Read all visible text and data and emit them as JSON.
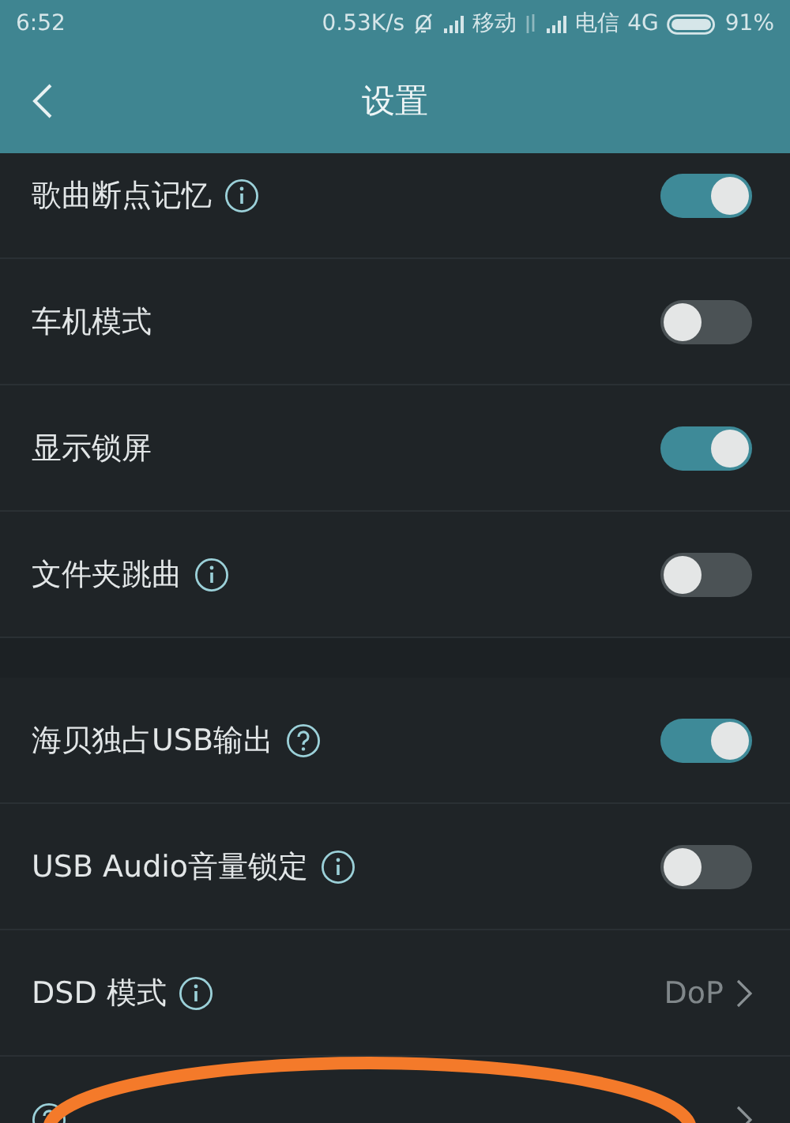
{
  "status_bar": {
    "time": "6:52",
    "speed": "0.53K/s",
    "carrier_1": "移动",
    "carrier_2": "电信",
    "network": "4G",
    "battery": "91%"
  },
  "header": {
    "title": "设置"
  },
  "sections": [
    {
      "items": [
        {
          "kind": "toggle",
          "label": "歌曲断点记忆",
          "hint": {
            "kind": "info"
          },
          "on": true
        },
        {
          "kind": "toggle",
          "label": "车机模式",
          "on": false
        },
        {
          "kind": "toggle",
          "label": "显示锁屏",
          "on": true
        },
        {
          "kind": "toggle",
          "label": "文件夹跳曲",
          "hint": {
            "kind": "info"
          },
          "on": false
        }
      ]
    },
    {
      "items": [
        {
          "kind": "toggle",
          "label": "海贝独占USB输出",
          "hint": {
            "kind": "help"
          },
          "on": true
        },
        {
          "kind": "toggle",
          "label": "USB Audio音量锁定",
          "hint": {
            "kind": "info"
          },
          "on": false
        },
        {
          "kind": "link",
          "label": "DSD 模式",
          "hint": {
            "kind": "info"
          },
          "value": "DoP"
        },
        {
          "kind": "link",
          "hint": {
            "kind": "help"
          }
        }
      ]
    }
  ],
  "highlight_ellipse": true
}
